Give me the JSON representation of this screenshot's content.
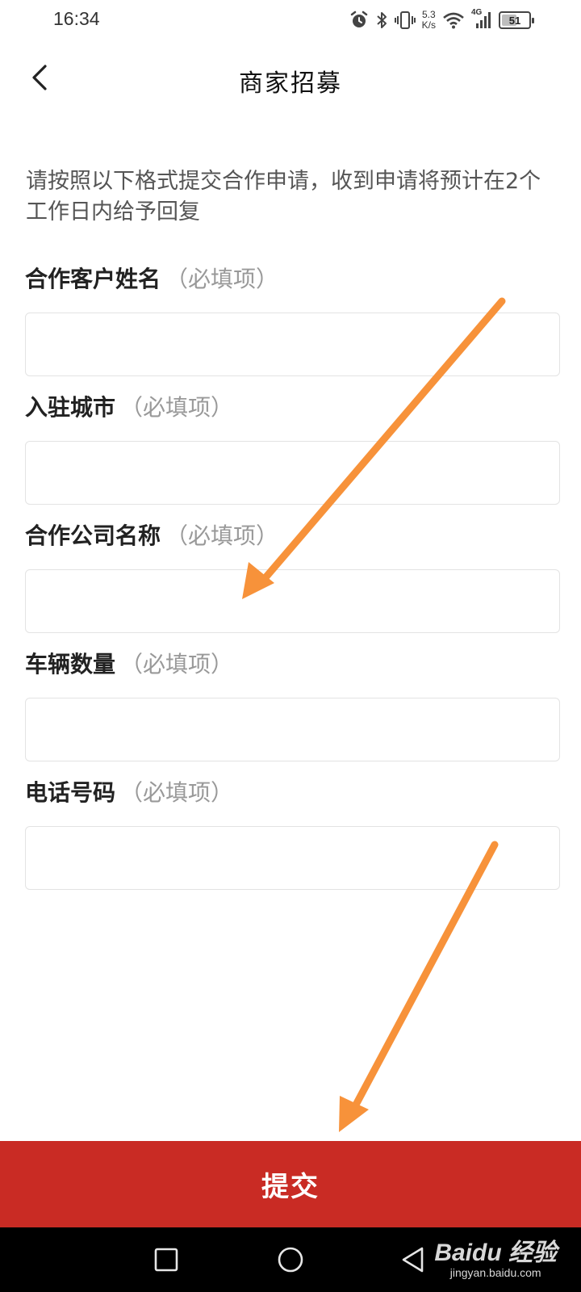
{
  "status_bar": {
    "time": "16:34",
    "net_speed_value": "5.3",
    "net_speed_unit": "K/s",
    "network_type": "4G",
    "battery_level": "51",
    "icons": [
      "alarm-icon",
      "bluetooth-icon",
      "vibrate-icon",
      "wifi-icon",
      "cellular-signal-icon",
      "battery-icon"
    ]
  },
  "header": {
    "back_icon": "chevron-left-icon",
    "title": "商家招募"
  },
  "intro": "请按照以下格式提交合作申请，收到申请将预计在2个工作日内给予回复",
  "form": {
    "required_suffix": "（必填项）",
    "fields": [
      {
        "label": "合作客户姓名",
        "value": ""
      },
      {
        "label": "入驻城市",
        "value": ""
      },
      {
        "label": "合作公司名称",
        "value": ""
      },
      {
        "label": "车辆数量",
        "value": ""
      },
      {
        "label": "电话号码",
        "value": ""
      }
    ]
  },
  "submit_label": "提交",
  "nav_bar": {
    "icons": [
      "recent-apps-icon",
      "home-icon",
      "back-triangle-icon"
    ]
  },
  "watermark": {
    "brand": "Baidu 经验",
    "url": "jingyan.baidu.com"
  },
  "colors": {
    "submit_button": "#c92b24",
    "annotation_arrow": "#f7923a",
    "nav_bar": "#000000"
  }
}
